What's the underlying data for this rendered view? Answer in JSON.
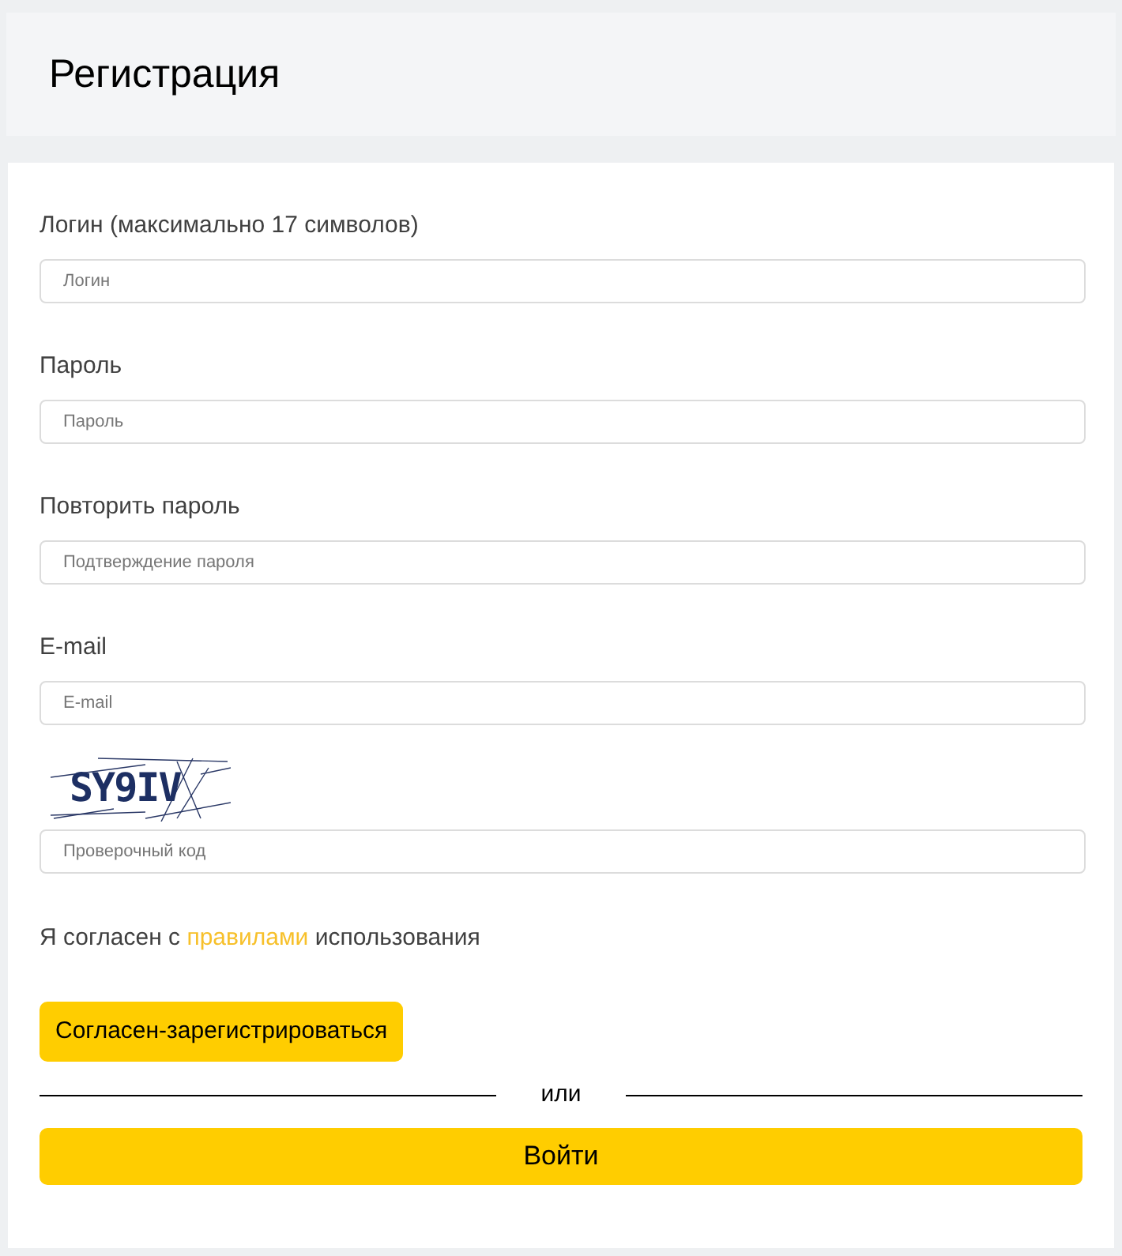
{
  "header": {
    "title": "Регистрация"
  },
  "fields": [
    {
      "label": "Логин (максимально 17 символов)",
      "placeholder": "Логин"
    },
    {
      "label": "Пароль",
      "placeholder": "Пароль"
    },
    {
      "label": "Повторить пароль",
      "placeholder": "Подтверждение пароля"
    },
    {
      "label": "E-mail",
      "placeholder": "E-mail"
    }
  ],
  "captcha": {
    "code": "SY9IV",
    "placeholder": "Проверочный код"
  },
  "agreement": {
    "before": "Я согласен с",
    "link": "правилами",
    "after": "использования"
  },
  "register_button": "Согласен-зарегистрироваться",
  "divider_text": "или",
  "login_button": "Войти"
}
